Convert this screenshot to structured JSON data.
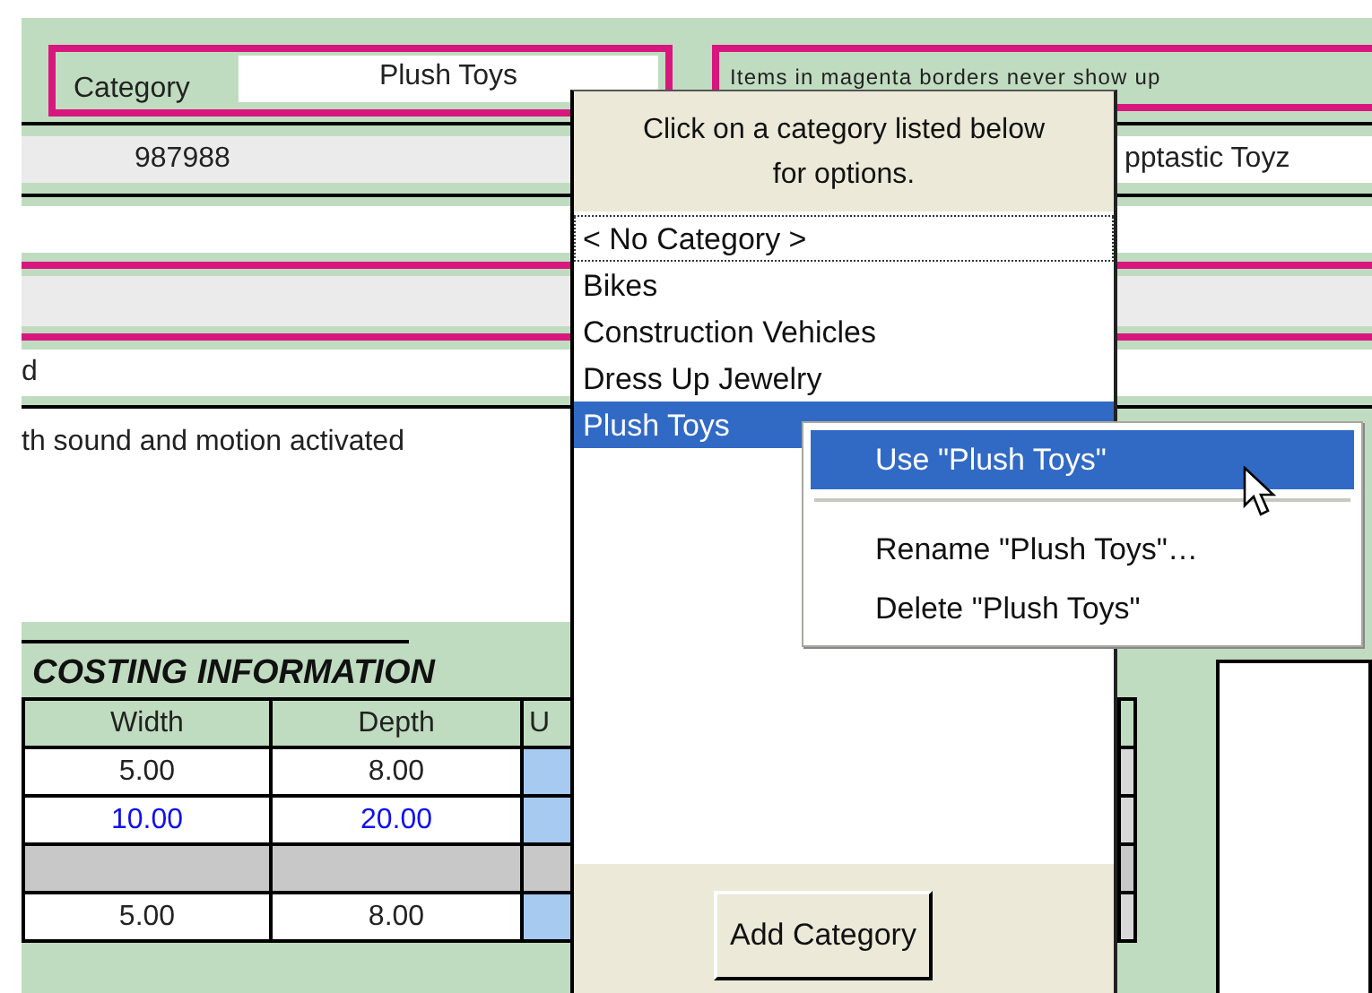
{
  "category_field": {
    "label": "Category",
    "value": "Plush Toys"
  },
  "notice": "Items in magenta borders never show up",
  "item_number": "987988",
  "vendor": "pptastic Toyz",
  "field_4": "d",
  "description": "th sound and motion activated",
  "costing": {
    "title": "COSTING INFORMATION",
    "columns": [
      "Width",
      "Depth",
      "U"
    ],
    "rows": [
      {
        "kind": "normal",
        "cells": [
          "5.00",
          "8.00"
        ]
      },
      {
        "kind": "override",
        "cells": [
          "10.00",
          "20.00"
        ]
      },
      {
        "kind": "blank"
      },
      {
        "kind": "normal",
        "cells": [
          "5.00",
          "8.00"
        ]
      }
    ]
  },
  "category_popup": {
    "hint": "Click on a category listed below for options.",
    "items": [
      {
        "label": "< No Category >",
        "selected": false,
        "focused": true
      },
      {
        "label": "Bikes",
        "selected": false,
        "focused": false
      },
      {
        "label": "Construction Vehicles",
        "selected": false,
        "focused": false
      },
      {
        "label": "Dress Up Jewelry",
        "selected": false,
        "focused": false
      },
      {
        "label": "Plush Toys",
        "selected": true,
        "focused": false
      }
    ],
    "button": "Add Category"
  },
  "context_menu": {
    "items": [
      {
        "kind": "item",
        "label": "Use \"Plush Toys\"",
        "highlighted": true
      },
      {
        "kind": "separator"
      },
      {
        "kind": "item",
        "label": "Rename \"Plush Toys\"…",
        "highlighted": false
      },
      {
        "kind": "item",
        "label": "Delete \"Plush Toys\"",
        "highlighted": false
      }
    ]
  }
}
